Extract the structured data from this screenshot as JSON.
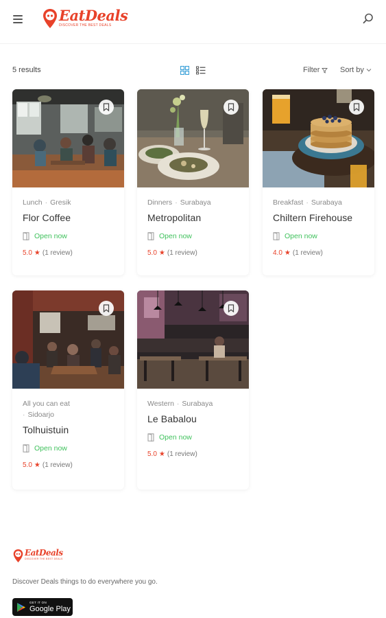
{
  "brand": {
    "name": "EatDeals",
    "tagline": "DISCOVER THE BEST DEALS",
    "color": "#e8422a"
  },
  "toolbar": {
    "results": "5 results",
    "filter_label": "Filter",
    "sort_label": "Sort by"
  },
  "colors": {
    "accent": "#e8422a",
    "open": "#3fc15c",
    "grid_active": "#3aa0d8"
  },
  "listings": [
    {
      "category": "Lunch",
      "city": "Gresik",
      "name": "Flor Coffee",
      "status": "Open now",
      "score": "5.0",
      "reviews": "(1 review)"
    },
    {
      "category": "Dinners",
      "city": "Surabaya",
      "name": "Metropolitan",
      "status": "Open now",
      "score": "5.0",
      "reviews": "(1 review)"
    },
    {
      "category": "Breakfast",
      "city": "Surabaya",
      "name": "Chiltern Firehouse",
      "status": "Open now",
      "score": "4.0",
      "reviews": "(1 review)"
    },
    {
      "category": "All you can eat",
      "city": "Sidoarjo",
      "name": "Tolhuistuin",
      "status": "Open now",
      "score": "5.0",
      "reviews": "(1 review)"
    },
    {
      "category": "Western",
      "city": "Surabaya",
      "name": "Le Babalou",
      "status": "Open now",
      "score": "5.0",
      "reviews": "(1 review)"
    }
  ],
  "footer": {
    "brand_name": "EatDeals",
    "tagline": "DISCOVER THE BEST DEALS",
    "description": "Discover Deals things to do everywhere you go.",
    "store_small": "GET IT ON",
    "store_big": "Google Play"
  }
}
